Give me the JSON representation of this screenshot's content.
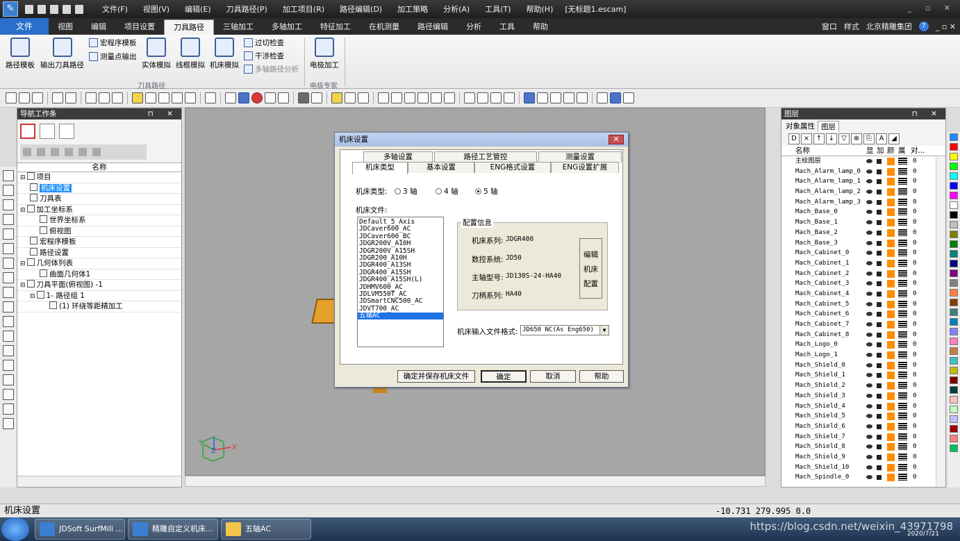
{
  "titlebar": {
    "menus": [
      "文件(F)",
      "视图(V)",
      "编辑(E)",
      "刀具路径(P)",
      "加工项目(R)",
      "路径编辑(D)",
      "加工策略",
      "分析(A)",
      "工具(T)",
      "帮助(H)"
    ],
    "document": "[无标题1.escam]"
  },
  "ribbon_tabs": {
    "file": "文件",
    "tabs": [
      "视图",
      "编辑",
      "项目设置",
      "刀具路径",
      "三轴加工",
      "多轴加工",
      "特征加工",
      "在机测量",
      "路径编辑",
      "分析",
      "工具",
      "帮助"
    ],
    "active": "刀具路径",
    "right": {
      "window": "窗口",
      "style": "样式",
      "company": "北京精雕集团"
    }
  },
  "ribbon": {
    "path_template": "路径模板",
    "export_tool_path": "输出刀具路径",
    "macro_template": "宏程序模板",
    "export_measure_points": "测量点输出",
    "solid_sim": "实体模拟",
    "wireframe_sim": "线框模拟",
    "machine_sim": "机床模拟",
    "overcut_check": "过切检查",
    "interference_check": "干涉检查",
    "multiaxis_analysis": "多轴路径分析",
    "group_toolpath": "刀具路径",
    "edm": "电极加工",
    "group_edm": "电极专家"
  },
  "nav": {
    "header": "导航工作条",
    "column": "名称",
    "tree": [
      {
        "label": "项目",
        "indent": 0,
        "toggle": "−"
      },
      {
        "label": "机床设置",
        "indent": 1,
        "selected": true
      },
      {
        "label": "刀具表",
        "indent": 1
      },
      {
        "label": "加工坐标系",
        "indent": 0,
        "toggle": "−"
      },
      {
        "label": "世界坐标系",
        "indent": 2
      },
      {
        "label": "俯视图",
        "indent": 2
      },
      {
        "label": "宏程序模板",
        "indent": 1
      },
      {
        "label": "路径设置",
        "indent": 1
      },
      {
        "label": "几何体列表",
        "indent": 0,
        "toggle": "−"
      },
      {
        "label": "曲面几何体1",
        "indent": 2
      },
      {
        "label": "刀具平面(俯视图) -1",
        "indent": 0,
        "toggle": "−"
      },
      {
        "label": "1- 路径组 1",
        "indent": 1,
        "toggle": "−"
      },
      {
        "label": "(1) 环绕等距精加工",
        "indent": 3
      }
    ]
  },
  "layers": {
    "header": "图层",
    "tabs": [
      "对象属性",
      "图层"
    ],
    "active_tab": "图层",
    "columns": {
      "name": "名称",
      "show": "显",
      "lock": "加",
      "color": "颜",
      "attr": "属",
      "obj": "对..."
    },
    "rows": [
      "主绘图层",
      "Mach_Alarm_lamp_0",
      "Mach_Alarm_lamp_1",
      "Mach_Alarm_lamp_2",
      "Mach_Alarm_lamp_3",
      "Mach_Base_0",
      "Mach_Base_1",
      "Mach_Base_2",
      "Mach_Base_3",
      "Mach_Cabinet_0",
      "Mach_Cabinet_1",
      "Mach_Cabinet_2",
      "Mach_Cabinet_3",
      "Mach_Cabinet_4",
      "Mach_Cabinet_5",
      "Mach_Cabinet_6",
      "Mach_Cabinet_7",
      "Mach_Cabinet_8",
      "Mach_Logo_0",
      "Mach_Logo_1",
      "Mach_Shield_0",
      "Mach_Shield_1",
      "Mach_Shield_2",
      "Mach_Shield_3",
      "Mach_Shield_4",
      "Mach_Shield_5",
      "Mach_Shield_6",
      "Mach_Shield_7",
      "Mach_Shield_8",
      "Mach_Shield_9",
      "Mach_Shield_10",
      "Mach_Spindle_0"
    ],
    "object_count": "0",
    "layer_color": "#ff8c00"
  },
  "palette": [
    "#1a8cff",
    "#ff0000",
    "#ffff00",
    "#00ff00",
    "#00ffff",
    "#0000ff",
    "#ff00ff",
    "#ffffff",
    "#000000",
    "#c0c0c0",
    "#808000",
    "#008000",
    "#008080",
    "#000080",
    "#800080",
    "#808080",
    "#ff8040",
    "#804000",
    "#408080",
    "#0080c0",
    "#8080ff",
    "#ff80c0",
    "#c08040",
    "#40c0c0",
    "#c0c000",
    "#800000",
    "#004040",
    "#ffc0c0",
    "#c0ffc0",
    "#c0c0ff",
    "#a00000",
    "#ff8080",
    "#00c060"
  ],
  "dialog": {
    "title": "机床设置",
    "tabs_back": [
      "多轴设置",
      "路径工艺管控",
      "测量设置"
    ],
    "tabs_front": [
      "机床类型",
      "基本设置",
      "ENG格式设置",
      "ENG设置扩展"
    ],
    "machine_type_label": "机床类型:",
    "axis_options": [
      "3 轴",
      "4 轴",
      "5 轴"
    ],
    "axis_selected": "5 轴",
    "machine_file_label": "机床文件:",
    "machine_files": [
      "Default_5_Axis",
      "JDCaver600_AC",
      "JDCaver600_BC",
      "JDGR200V_A10H",
      "JDGR200V_A15SH",
      "JDGR200_A10H",
      "JDGR400_A13SH",
      "JDGR400_A15SH",
      "JDGR400_A15SH(L)",
      "JDHMV600_AC",
      "JDLVM550T_AC",
      "JDSmartCNC500_AC",
      "JDVT700_AC",
      "五轴AC"
    ],
    "machine_file_selected": "五轴AC",
    "config_title": "配置信息",
    "config": [
      {
        "k": "机床系列:",
        "v": "JDGR400"
      },
      {
        "k": "数控系统:",
        "v": "JD50"
      },
      {
        "k": "主轴型号:",
        "v": "JD130S-24-HA40"
      },
      {
        "k": "刀柄系列:",
        "v": "HA40"
      }
    ],
    "edit_config": [
      "编辑",
      "机床",
      "配置"
    ],
    "input_format_label": "机床输入文件格式:",
    "input_format_value": "JD650 NC(As Eng650)",
    "buttons": {
      "save": "确定并保存机床文件",
      "ok": "确定",
      "cancel": "取消",
      "help": "帮助"
    }
  },
  "status": {
    "text": "机床设置",
    "coords": "-10.731 279.995 0.0"
  },
  "taskbar": {
    "tasks": [
      "JDSoft SurfMill ...",
      "精雕自定义机床...",
      "五轴AC"
    ],
    "watermark": "https://blog.csdn.net/weixin_43971798",
    "date": "2020/7/21"
  }
}
